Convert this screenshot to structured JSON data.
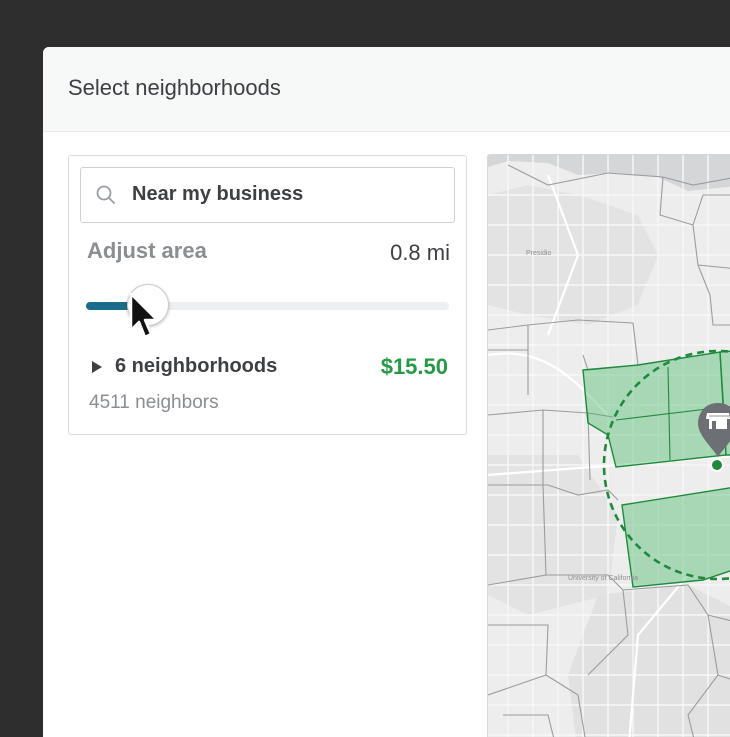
{
  "dialog": {
    "title": "Select neighborhoods"
  },
  "search": {
    "value": "Near my business",
    "icon": "search-icon"
  },
  "area": {
    "label": "Adjust area",
    "value_text": "0.8 mi",
    "slider_fraction": 0.17
  },
  "summary": {
    "neighborhoods": "6 neighborhoods",
    "price": "$15.50",
    "neighbors": "4511 neighbors"
  },
  "map": {
    "labels": [
      "Presidio",
      "University of California"
    ],
    "marker_icon": "store-icon",
    "selected_color": "#36b45a",
    "radius_color": "#1f8a3c"
  },
  "colors": {
    "accent": "#1a6b8c",
    "price": "#249a46"
  }
}
